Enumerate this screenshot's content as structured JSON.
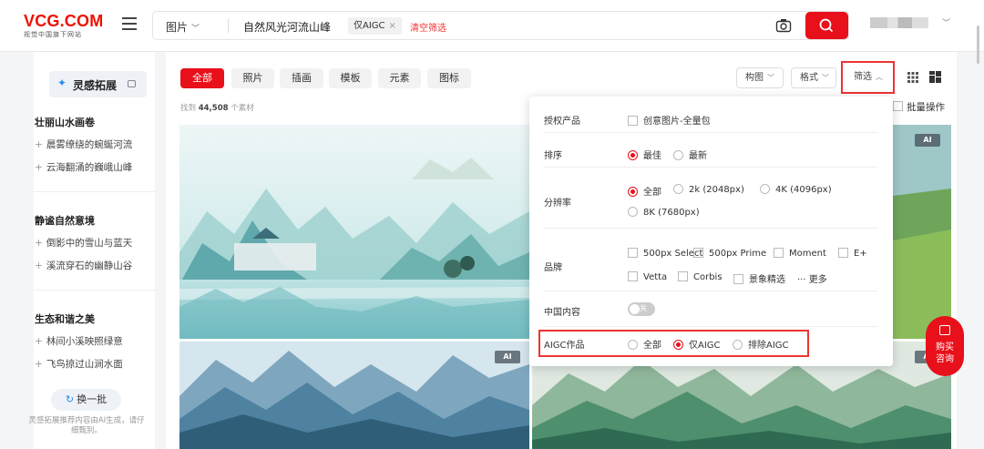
{
  "header": {
    "logo_brand": "VCG.COM",
    "logo_tagline": "视觉中国旗下网站",
    "category": "图片",
    "query": "自然风光河流山峰",
    "filter_chip": "仅AIGC",
    "clear_filters": "清空筛选",
    "icons": {
      "menu": "menu-icon",
      "camera": "camera-icon",
      "search": "search-icon",
      "caret": "chevron-down-icon"
    }
  },
  "sidebar": {
    "title": "灵感拓展",
    "groups": [
      {
        "title": "壮丽山水画卷",
        "items": [
          "晨雾缭绕的蜿蜒河流",
          "云海翻涌的巍峨山峰"
        ]
      },
      {
        "title": "静谧自然意境",
        "items": [
          "倒影中的雪山与蓝天",
          "溪流穿石的幽静山谷"
        ]
      },
      {
        "title": "生态和谐之美",
        "items": [
          "林间小溪映照绿意",
          "飞鸟掠过山涧水面"
        ]
      }
    ],
    "refresh_label": "换一批",
    "note": "灵感拓展推荐内容由AI生成，请仔细甄别。"
  },
  "main": {
    "tabs": [
      "全部",
      "照片",
      "插画",
      "模板",
      "元素",
      "图标"
    ],
    "active_tab": "全部",
    "found_prefix": "找到",
    "found_count": "44,508",
    "found_suffix": "个素材",
    "tools": {
      "composition": "构图",
      "format": "格式",
      "filter": "筛选"
    },
    "batch_label": "批量操作",
    "ai_badge": "AI"
  },
  "filter_panel": {
    "license": {
      "label": "授权产品",
      "options": [
        "创意图片-全量包"
      ]
    },
    "sort": {
      "label": "排序",
      "options": [
        "最佳",
        "最新"
      ],
      "selected": "最佳"
    },
    "resolution": {
      "label": "分辨率",
      "options": [
        "全部",
        "2k (2048px)",
        "4K (4096px)",
        "8K (7680px)"
      ],
      "selected": "全部"
    },
    "brand": {
      "label": "品牌",
      "options": [
        "500px Select",
        "500px Prime",
        "Moment",
        "E+",
        "Vetta",
        "Corbis",
        "景象精选"
      ],
      "more": "··· 更多"
    },
    "china": {
      "label": "中国内容",
      "toggle_text": "关",
      "enabled": false
    },
    "aigc": {
      "label": "AIGC作品",
      "options": [
        "全部",
        "仅AIGC",
        "排除AIGC"
      ],
      "selected": "仅AIGC"
    }
  },
  "float_button": {
    "line1": "购买",
    "line2": "咨询"
  },
  "colors": {
    "accent": "#e8101a",
    "highlight_box": "#e33333",
    "link_blue": "#2a8cf0"
  }
}
